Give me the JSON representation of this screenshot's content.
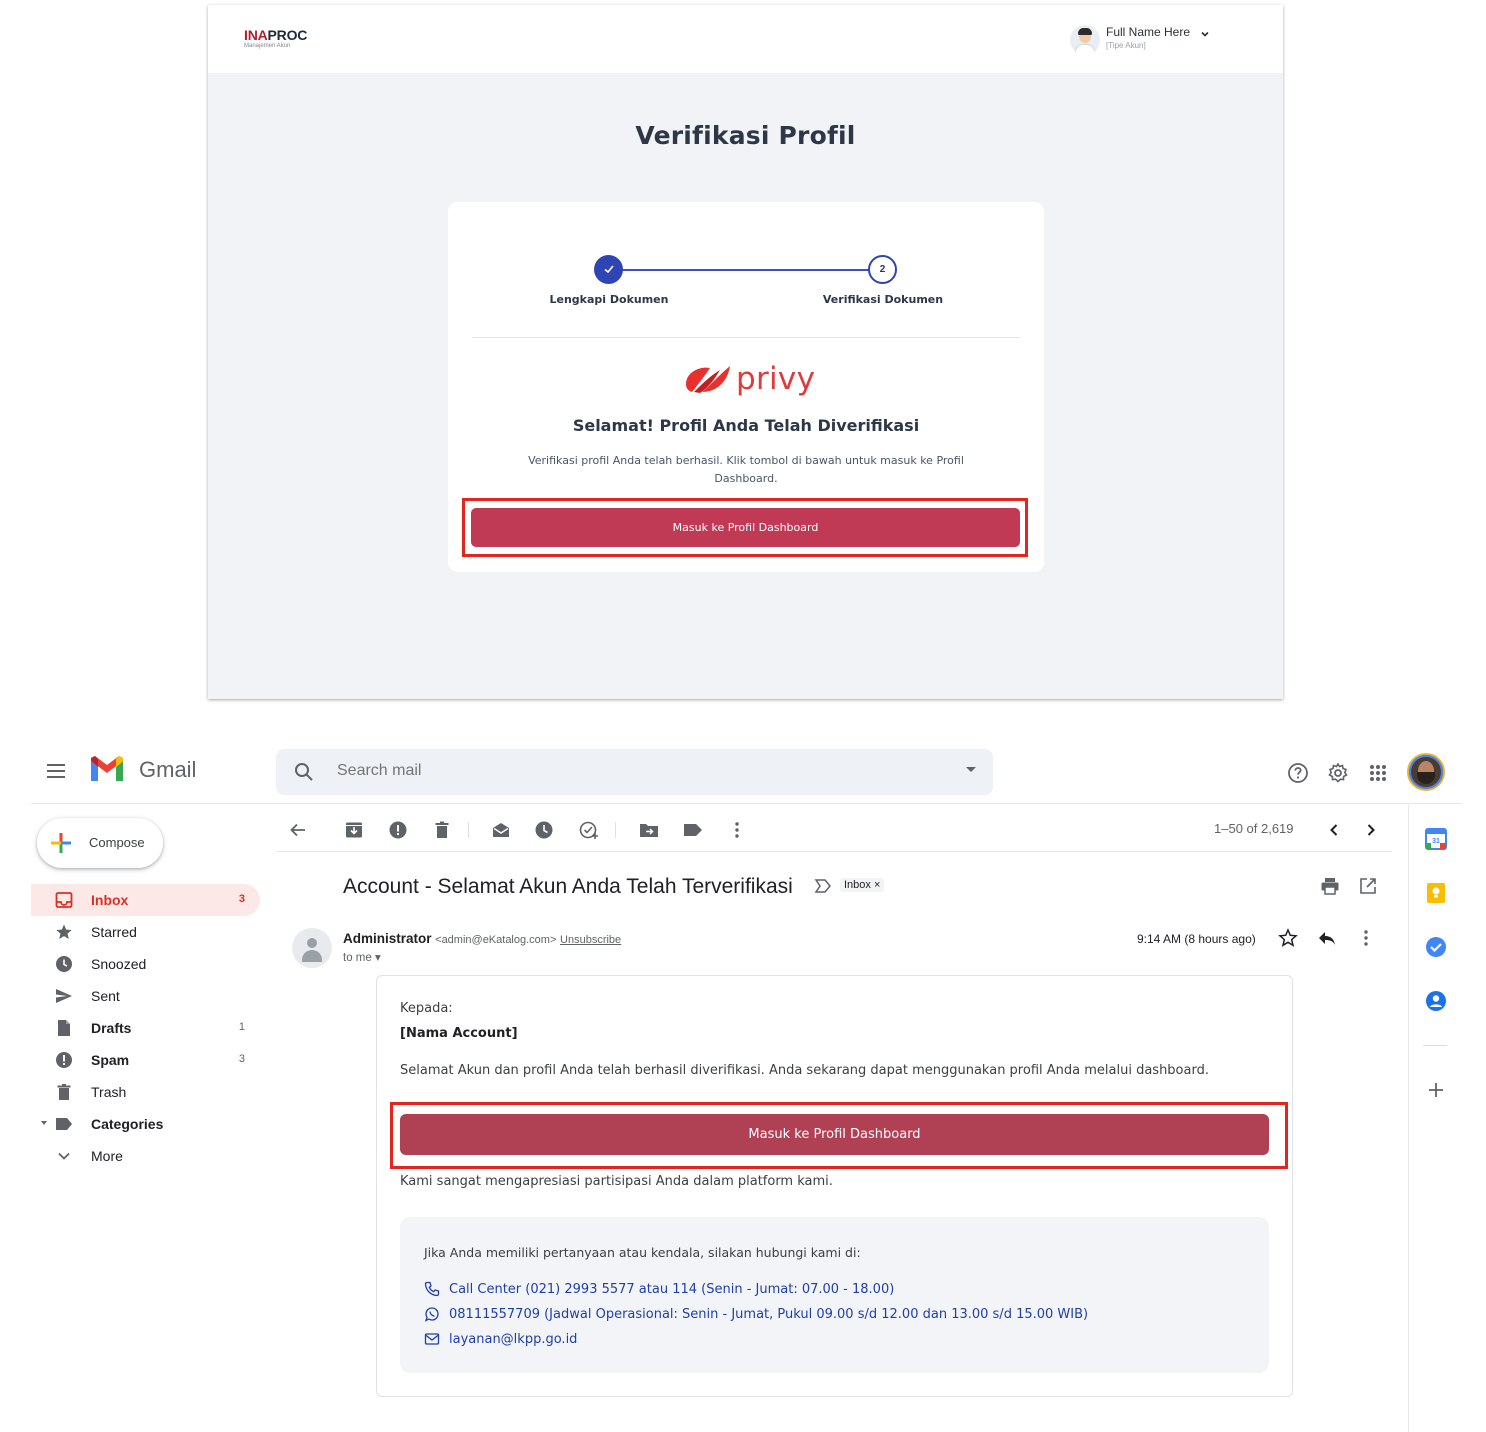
{
  "inaproc": {
    "logo": {
      "part1": "INA",
      "part2": "PROC",
      "subtitle": "Manajemen Akun"
    },
    "user": {
      "name": "Full Name Here",
      "role": "[Tipe Akun]"
    },
    "title": "Verifikasi Profil",
    "steps": [
      {
        "number": "",
        "label": "Lengkapi Dokumen",
        "state": "done"
      },
      {
        "number": "2",
        "label": "Verifikasi Dokumen",
        "state": "current"
      }
    ],
    "brand": "privy",
    "heading": "Selamat! Profil Anda Telah Diverifikasi",
    "description": "Verifikasi profil Anda telah berhasil. Klik tombol di bawah untuk masuk ke Profil Dashboard.",
    "button_label": "Masuk ke Profil Dashboard",
    "colors": {
      "button": "#c13a55",
      "step": "#2f44b5",
      "highlight": "#e0261f",
      "brand": "#e13a3a"
    }
  },
  "gmail": {
    "app_name": "Gmail",
    "search_placeholder": "Search mail",
    "compose_label": "Compose",
    "nav": [
      {
        "label": "Inbox",
        "count": "3",
        "icon": "inbox-icon",
        "active": true,
        "bold": true
      },
      {
        "label": "Starred",
        "count": "",
        "icon": "star-icon"
      },
      {
        "label": "Snoozed",
        "count": "",
        "icon": "clock-icon"
      },
      {
        "label": "Sent",
        "count": "",
        "icon": "send-icon"
      },
      {
        "label": "Drafts",
        "count": "1",
        "icon": "draft-icon",
        "bold": true
      },
      {
        "label": "Spam",
        "count": "3",
        "icon": "spam-icon",
        "bold": true
      },
      {
        "label": "Trash",
        "count": "",
        "icon": "trash-icon"
      },
      {
        "label": "Categories",
        "count": "",
        "icon": "label-icon",
        "bold": true
      },
      {
        "label": "More",
        "count": "",
        "icon": "chevron-down-icon"
      }
    ],
    "pager": "1–50 of 2,619",
    "subject": "Account - Selamat Akun Anda Telah Terverifikasi",
    "inbox_tag": "Inbox ×",
    "sender": {
      "name": "Administrator",
      "email": "<admin@eKatalog.com>",
      "unsubscribe": "Unsubscribe",
      "to": "to me ▾",
      "time": "9:14 AM (8 hours ago)"
    },
    "email": {
      "greeting": "Kepada:",
      "recipient": "[Nama Account]",
      "message": "Selamat Akun dan profil Anda telah berhasil diverifikasi. Anda sekarang dapat menggunakan profil Anda melalui dashboard.",
      "button_label": "Masuk ke Profil Dashboard",
      "thanks": "Kami sangat mengapresiasi partisipasi Anda dalam platform kami.",
      "contact_title": "Jika Anda memiliki pertanyaan atau kendala, silakan hubungi kami di:",
      "contacts": [
        {
          "icon": "phone-icon",
          "text": "Call Center (021) 2993 5577 atau 114 (Senin - Jumat: 07.00 - 18.00)"
        },
        {
          "icon": "whatsapp-icon",
          "text": "08111557709 (Jadwal Operasional: Senin - Jumat, Pukul 09.00 s/d 12.00 dan  13.00 s/d 15.00 WIB)"
        },
        {
          "icon": "mail-icon",
          "text": "layanan@lkpp.go.id"
        }
      ]
    },
    "colors": {
      "button": "#b04155",
      "active_nav": "#fce8e6",
      "link": "#1f3fa8"
    }
  }
}
